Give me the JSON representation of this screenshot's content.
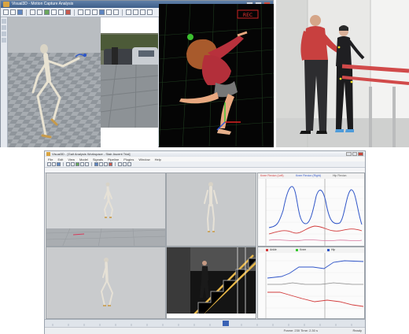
{
  "top_app": {
    "title": "Visual3D - Motion Capture Analysis",
    "recording_indicator": "REC"
  },
  "bottom_app": {
    "title": "Visual3D - [Gait Analysis Workspace - Stair Ascent Trial]",
    "menus": [
      "File",
      "Edit",
      "View",
      "Model",
      "Signals",
      "Pipeline",
      "Plugins",
      "Window",
      "Help"
    ],
    "graph1_legend": [
      "Knee Flexion (Left)",
      "Knee Flexion (Right)",
      "Hip Flexion"
    ],
    "graph2_legend": [
      "Ankle",
      "Knee",
      "Hip"
    ],
    "status_text": "Frame: 230   Time: 2.30 s",
    "status_right": "Ready"
  },
  "colors": {
    "accent_blue": "#3a62b5",
    "curve_blue": "#2f55c8",
    "curve_red": "#d23c3c",
    "curve_pink": "#d87aa0"
  }
}
